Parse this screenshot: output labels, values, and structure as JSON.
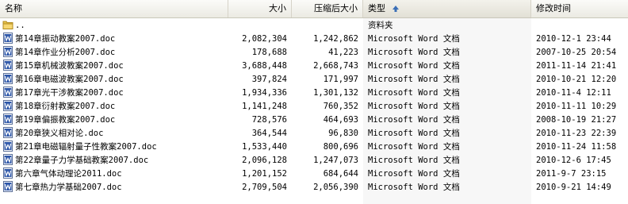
{
  "columns": {
    "name": "名称",
    "size": "大小",
    "compressed": "压缩后大小",
    "type": "类型",
    "modified": "修改时间"
  },
  "parent_folder": {
    "name": "..",
    "type": "资料夹"
  },
  "files": [
    {
      "name": "第14章振动教案2007.doc",
      "size": "2,082,304",
      "compressed": "1,242,862",
      "type": "Microsoft Word 文档",
      "modified": "2010-12-1 23:44"
    },
    {
      "name": "第14章作业分析2007.doc",
      "size": "178,688",
      "compressed": "41,223",
      "type": "Microsoft Word 文档",
      "modified": "2007-10-25 20:54"
    },
    {
      "name": "第15章机械波教案2007.doc",
      "size": "3,688,448",
      "compressed": "2,668,743",
      "type": "Microsoft Word 文档",
      "modified": "2011-11-14 21:41"
    },
    {
      "name": "第16章电磁波教案2007.doc",
      "size": "397,824",
      "compressed": "171,997",
      "type": "Microsoft Word 文档",
      "modified": "2010-10-21 12:20"
    },
    {
      "name": "第17章光干涉教案2007.doc",
      "size": "1,934,336",
      "compressed": "1,301,132",
      "type": "Microsoft Word 文档",
      "modified": "2010-11-4 12:11"
    },
    {
      "name": "第18章衍射教案2007.doc",
      "size": "1,141,248",
      "compressed": "760,352",
      "type": "Microsoft Word 文档",
      "modified": "2010-11-11 10:29"
    },
    {
      "name": "第19章偏振教案2007.doc",
      "size": "728,576",
      "compressed": "464,693",
      "type": "Microsoft Word 文档",
      "modified": "2008-10-19 21:27"
    },
    {
      "name": "第20章狭义相对论.doc",
      "size": "364,544",
      "compressed": "96,830",
      "type": "Microsoft Word 文档",
      "modified": "2010-11-23 22:39"
    },
    {
      "name": "第21章电磁辐射量子性教案2007.doc",
      "size": "1,533,440",
      "compressed": "800,696",
      "type": "Microsoft Word 文档",
      "modified": "2010-11-24 11:58"
    },
    {
      "name": "第22章量子力学基础教案2007.doc",
      "size": "2,096,128",
      "compressed": "1,247,073",
      "type": "Microsoft Word 文档",
      "modified": "2010-12-6 17:45"
    },
    {
      "name": "第六章气体动理论2011.doc",
      "size": "1,201,152",
      "compressed": "684,644",
      "type": "Microsoft Word 文档",
      "modified": "2011-9-7 23:15"
    },
    {
      "name": "第七章热力学基础2007.doc",
      "size": "2,709,504",
      "compressed": "2,056,390",
      "type": "Microsoft Word 文档",
      "modified": "2010-9-21 14:49"
    }
  ],
  "icons": {
    "folder": "folder-up-icon",
    "file": "word-doc-icon",
    "sort": "sort-ascending-arrow-icon"
  },
  "colors": {
    "sort_arrow": "#3b6fb6",
    "word_icon": "#2b55a8",
    "folder": "#e8c24a"
  }
}
